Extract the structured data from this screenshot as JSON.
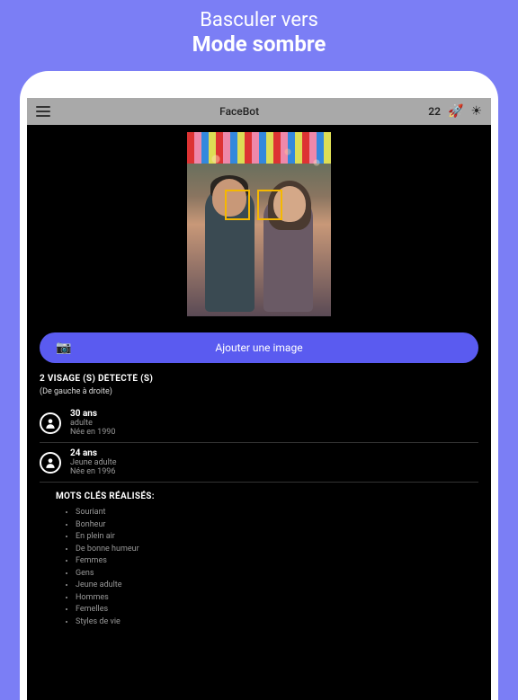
{
  "promo": {
    "line1": "Basculer vers",
    "line2": "Mode sombre"
  },
  "toolbar": {
    "title": "FaceBot",
    "count": "22"
  },
  "addButton": {
    "label": "Ajouter une image"
  },
  "detection": {
    "title": "2 VISAGE (S) DÉTECTÉ (S)",
    "subtitle": "(De gauche à droite)",
    "faces": [
      {
        "age": "30 ans",
        "category": "adulte",
        "born": "Née en 1990"
      },
      {
        "age": "24 ans",
        "category": "Jeune adulte",
        "born": "Née en 1996"
      }
    ]
  },
  "keywords": {
    "title": "MOTS CLÉS RÉALISÉS:",
    "items": [
      "Souriant",
      "Bonheur",
      "En plein air",
      "De bonne humeur",
      "Femmes",
      "Gens",
      "Jeune adulte",
      "Hommes",
      "Femelles",
      "Styles de vie"
    ]
  }
}
